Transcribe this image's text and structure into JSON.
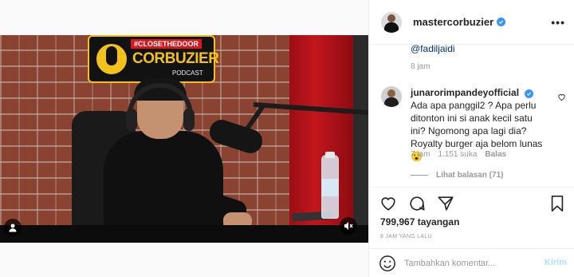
{
  "post": {
    "username": "mastercorbuzier",
    "verified": true,
    "more_icon": "more-horizontal-icon"
  },
  "video": {
    "overlay_logo": {
      "hashtag": "#CLOSETHEDOOR",
      "name": "CORBUZIER",
      "subtitle": "PODCAST"
    },
    "user_tag_icon": "user-tag-icon",
    "mute_icon": "speaker-muted-icon"
  },
  "comments": {
    "previous": {
      "mention": "@fadiljaidi",
      "time": "8 jam"
    },
    "items": [
      {
        "username": "junarorimpandeyofficial",
        "verified": true,
        "text": "Ada apa panggil2 ? Apa perlu ditonton ini si anak kecil satu ini? Ngomong apa lagi dia? Royalty burger aja belom lunas 😮",
        "time": "7 jam",
        "likes": "1.151 suka",
        "reply_label": "Balas",
        "view_replies": "Lihat balasan (71)"
      }
    ]
  },
  "actions": {
    "icons": [
      "heart-icon",
      "comment-icon",
      "share-icon",
      "bookmark-icon"
    ],
    "view_count": "799,967 tayangan",
    "post_time": "8 JAM YANG LALU"
  },
  "comment_form": {
    "placeholder": "Tambahkan komentar...",
    "post_label": "Kirim"
  },
  "colors": {
    "verified": "#3897f0",
    "post_button_disabled": "#b2dffc",
    "mention": "#003569"
  }
}
